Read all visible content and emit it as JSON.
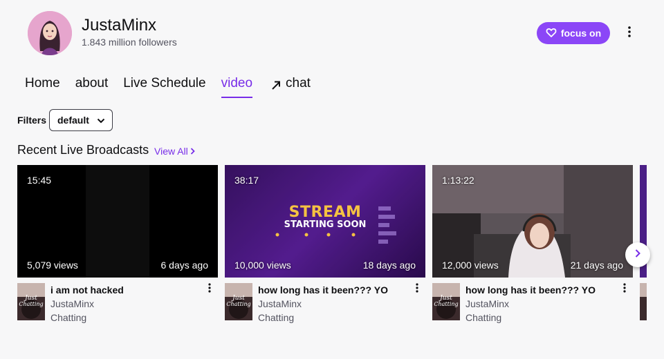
{
  "channel": {
    "name": "JustaMinx",
    "followers": "1.843 million followers",
    "focus_label": "focus on"
  },
  "nav": {
    "tabs": [
      {
        "label": "Home"
      },
      {
        "label": "about"
      },
      {
        "label": "Live Schedule"
      },
      {
        "label": "video",
        "active": true
      },
      {
        "label": "chat",
        "icon": "external-arrow-icon"
      }
    ]
  },
  "filters": {
    "label": "Filters",
    "selected": "default"
  },
  "section": {
    "title": "Recent Live Broadcasts",
    "view_all": "View All"
  },
  "videos": [
    {
      "duration": "15:45",
      "views": "5,079 views",
      "ago": "6 days ago",
      "title": "i am not hacked",
      "channel": "JustaMinx",
      "category": "Chatting"
    },
    {
      "duration": "38:17",
      "views": "10,000 views",
      "ago": "18 days ago",
      "title": "how long has it been??? YO",
      "channel": "JustaMinx",
      "category": "Chatting",
      "thumb_text": [
        "STREAM",
        "STARTING SOON"
      ]
    },
    {
      "duration": "1:13:22",
      "views": "12,000 views",
      "ago": "21 days ago",
      "title": "how long has it been??? YO",
      "channel": "JustaMinx",
      "category": "Chatting"
    }
  ],
  "colors": {
    "accent": "#772ce8",
    "button": "#8b46f7",
    "background": "#f7f7f8"
  }
}
